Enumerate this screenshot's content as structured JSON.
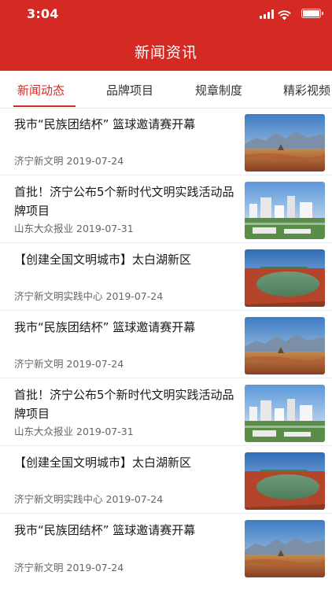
{
  "status_bar": {
    "time": "3:04"
  },
  "header": {
    "title": "新闻资讯"
  },
  "tabs": [
    {
      "label": "新闻动态",
      "active": true
    },
    {
      "label": "品牌项目",
      "active": false
    },
    {
      "label": "规章制度",
      "active": false
    },
    {
      "label": "精彩视频",
      "active": false
    }
  ],
  "news": [
    {
      "title": "我市“民族团结杯” 篮球邀请赛开幕",
      "source": "济宁新文明",
      "date": "2019-07-24",
      "image": "mountain-landscape"
    },
    {
      "title": "首批！济宁公布5个新时代文明实践活动品牌项目",
      "source": "山东大众报业",
      "date": "2019-07-31",
      "image": "city-buildings"
    },
    {
      "title": "【创建全国文明城市】太白湖新区",
      "source": "济宁新文明实践中心",
      "date": "2019-07-24",
      "image": "lake-aerial"
    },
    {
      "title": "我市“民族团结杯” 篮球邀请赛开幕",
      "source": "济宁新文明",
      "date": "2019-07-24",
      "image": "mountain-landscape"
    },
    {
      "title": "首批！济宁公布5个新时代文明实践活动品牌项目",
      "source": "山东大众报业",
      "date": "2019-07-31",
      "image": "city-buildings"
    },
    {
      "title": "【创建全国文明城市】太白湖新区",
      "source": "济宁新文明实践中心",
      "date": "2019-07-24",
      "image": "lake-aerial"
    },
    {
      "title": "我市“民族团结杯” 篮球邀请赛开幕",
      "source": "济宁新文明",
      "date": "2019-07-24",
      "image": "mountain-landscape"
    }
  ],
  "colors": {
    "brand": "#d42a23"
  }
}
